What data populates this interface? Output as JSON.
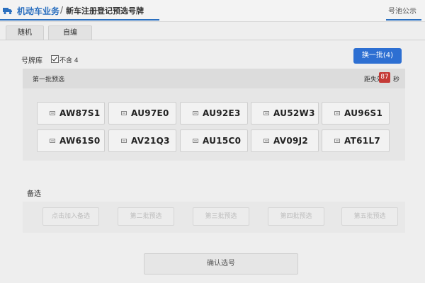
{
  "header": {
    "module": "机动车业务",
    "separator": "/",
    "page": "新车注册登记预选号牌",
    "right_link": "号池公示"
  },
  "tabs": [
    {
      "label": "随机"
    },
    {
      "label": "自编"
    }
  ],
  "library": {
    "label": "号牌库",
    "exclude_checked": true,
    "exclude_label": "不含 4",
    "swap_button": "换一批(4)"
  },
  "batch": {
    "title": "第一批预选",
    "expire_label": "距失效",
    "countdown": "87",
    "seconds_unit": "秒",
    "plates": [
      "AW87S1",
      "AU97E0",
      "AU92E3",
      "AU52W3",
      "AU96S1",
      "AW61S0",
      "AV21Q3",
      "AU15C0",
      "AV09J2",
      "AT61L7"
    ]
  },
  "alternates": {
    "label": "备选",
    "buttons": [
      "点击加入备选",
      "第二批预选",
      "第三批预选",
      "第四批预选",
      "第五批预选"
    ]
  },
  "confirm_button": "确认选号",
  "colors": {
    "accent": "#2d6fd2",
    "countdown": "#c43a36"
  }
}
